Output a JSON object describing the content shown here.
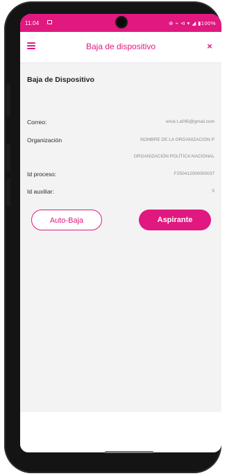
{
  "status_bar": {
    "time": "11:04",
    "icons_text": "⊕ ⌁ ⊲ ▾ ◢ ▮100%",
    "accent": "#e0187f"
  },
  "app_bar": {
    "title": "Baja de dispositivo",
    "menu_icon": "hamburger-icon",
    "close_label": "×"
  },
  "content": {
    "section_title": "Baja de Dispositivo",
    "fields": [
      {
        "label": "Correo:",
        "value": "erick.t.a095@gmail.com"
      },
      {
        "label": "Organización",
        "value": "NOMBRE DE LA ORGANIZACION P"
      },
      {
        "label": "",
        "value": "ORGANIZACIÓN POLÍTICA NACIONAL"
      },
      {
        "label": "Id proceso:",
        "value": "F250412000000037"
      },
      {
        "label": "Id auxiliar:",
        "value": "5"
      }
    ]
  },
  "buttons": {
    "auto_baja": "Auto-Baja",
    "aspirante": "Aspirante"
  },
  "colors": {
    "brand": "#e0187f",
    "background": "#f3f3f3",
    "text": "#222222",
    "muted": "#8a8a8a"
  }
}
